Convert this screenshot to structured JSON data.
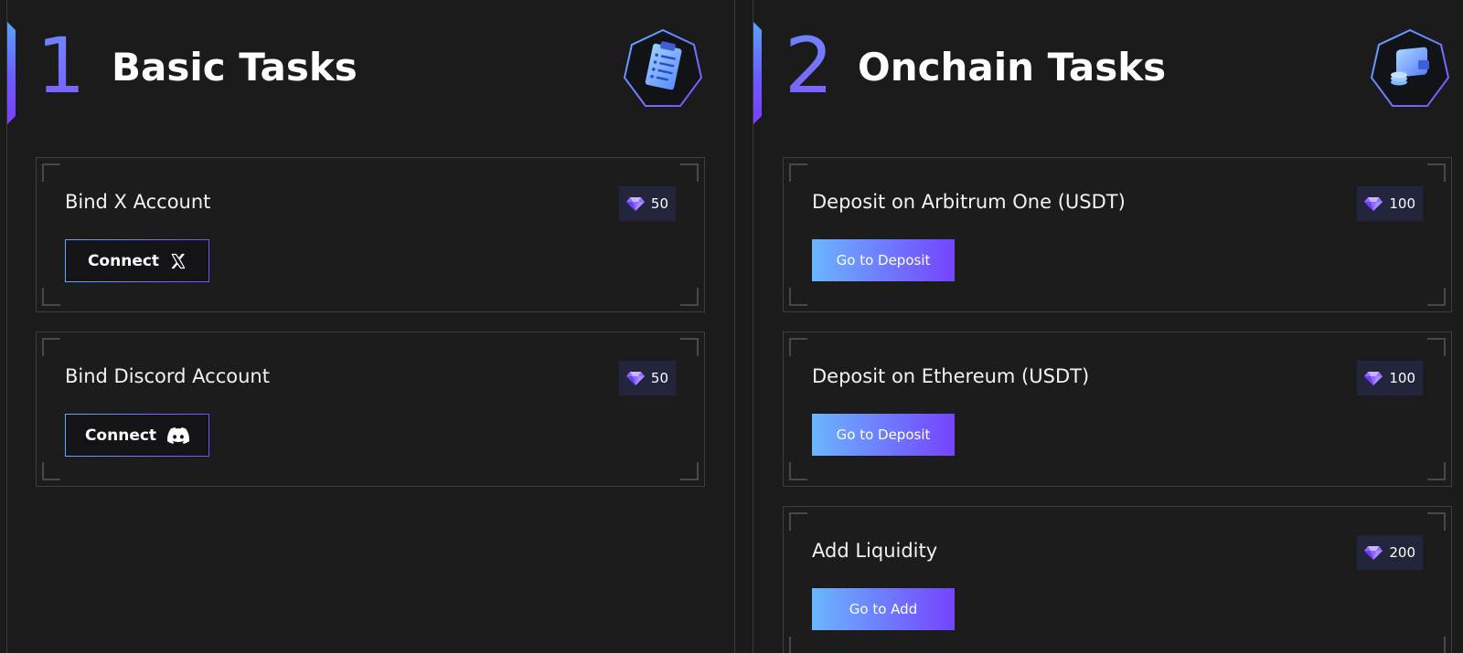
{
  "colors": {
    "background": "#1b1b1c",
    "card_border": "#3d3d40",
    "accent_blue": "#62a8ff",
    "accent_purple": "#7a4dff",
    "reward_bg": "#23253c"
  },
  "sections": [
    {
      "number": "1",
      "title": "Basic Tasks",
      "icon": "clipboard-checklist-icon",
      "tasks": [
        {
          "title": "Bind X Account",
          "reward": "50",
          "reward_icon": "diamond-gem-icon",
          "button_label": "Connect",
          "button_icon": "x-logo-icon"
        },
        {
          "title": "Bind Discord Account",
          "reward": "50",
          "reward_icon": "diamond-gem-icon",
          "button_label": "Connect",
          "button_icon": "discord-logo-icon"
        }
      ]
    },
    {
      "number": "2",
      "title": "Onchain Tasks",
      "icon": "wallet-coins-icon",
      "tasks": [
        {
          "title": "Deposit on Arbitrum One (USDT)",
          "reward": "100",
          "reward_icon": "diamond-gem-icon",
          "button_label": "Go to Deposit"
        },
        {
          "title": "Deposit on Ethereum (USDT)",
          "reward": "100",
          "reward_icon": "diamond-gem-icon",
          "button_label": "Go to Deposit"
        },
        {
          "title": "Add Liquidity",
          "reward": "200",
          "reward_icon": "diamond-gem-icon",
          "button_label": "Go to Add"
        }
      ]
    }
  ]
}
